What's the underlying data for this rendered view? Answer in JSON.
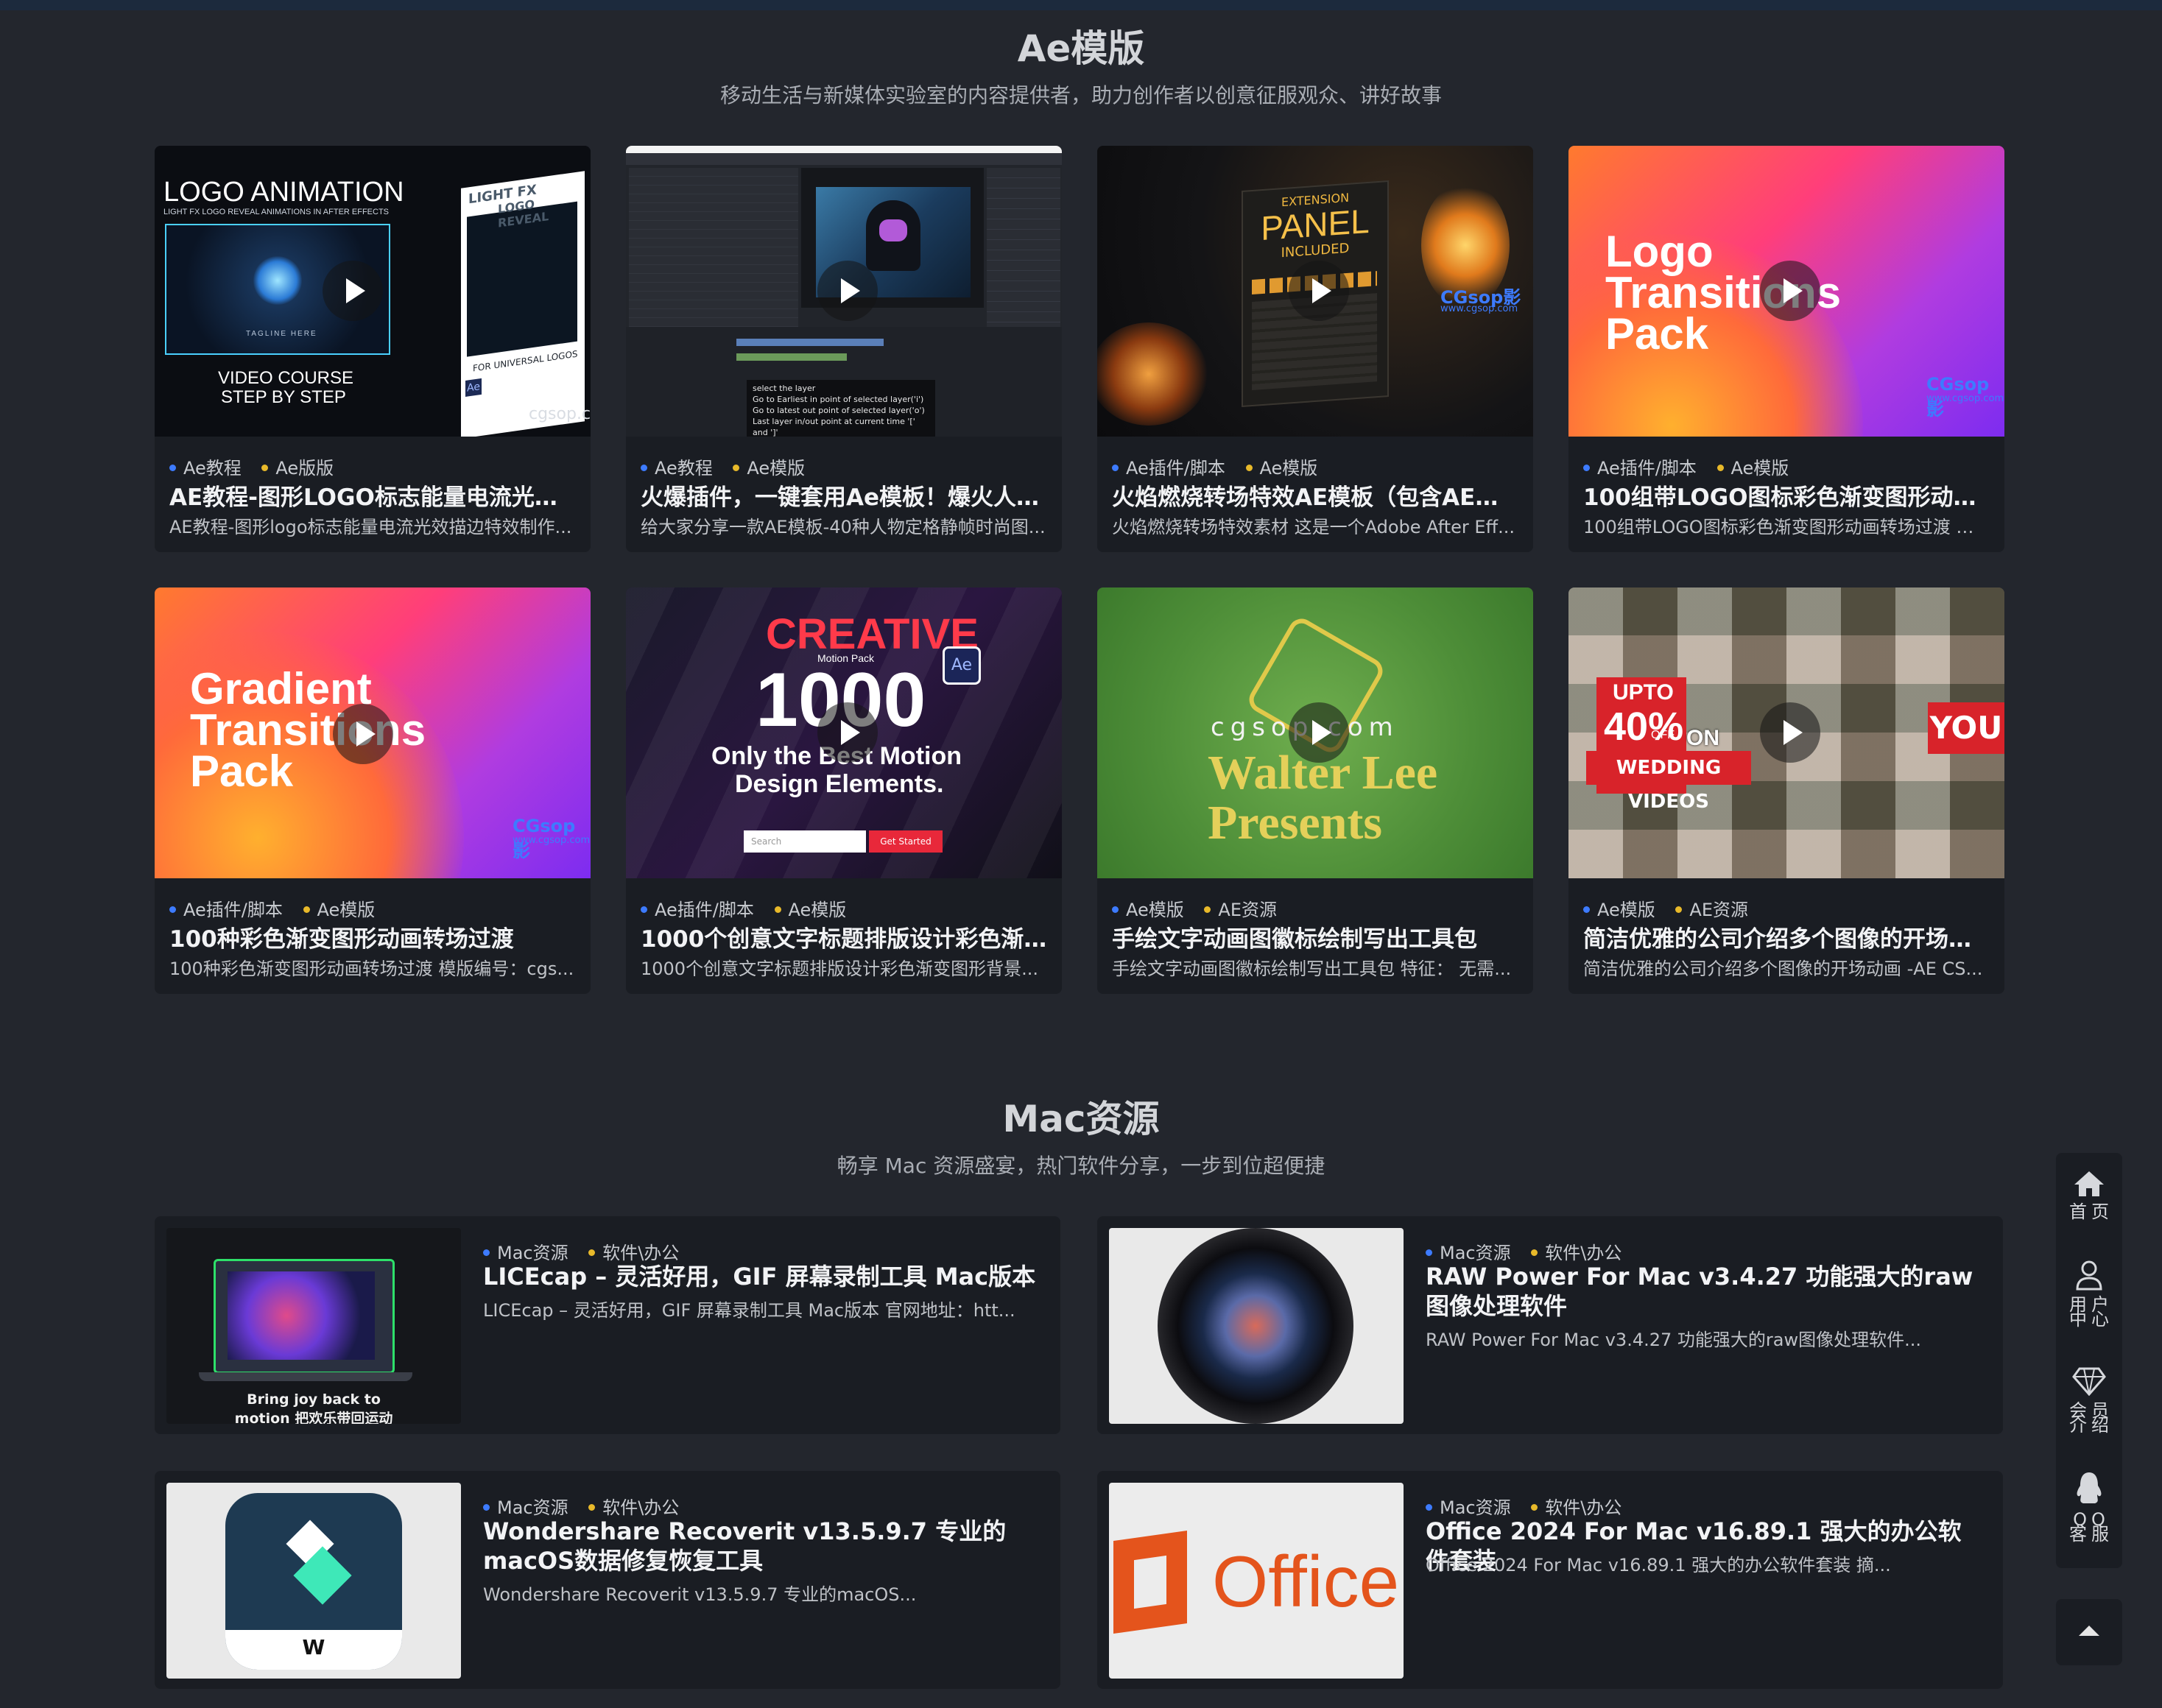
{
  "ae_section": {
    "title": "Ae模版",
    "subtitle": "移动生活与新媒体实验室的内容提供者，助力创作者以创意征服观众、讲好故事",
    "cards": [
      {
        "tags": [
          "Ae教程",
          "Ae版版"
        ],
        "title": "AE教程-图形LOGO标志能量电流光效...",
        "desc": "AE教程-图形logo标志能量电流光效描边特效制作..."
      },
      {
        "tags": [
          "Ae教程",
          "Ae模版"
        ],
        "title": "火爆插件，一键套用Ae模板！爆火人物...",
        "desc": "给大家分享一款AE模板-40种人物定格静帧时尚图..."
      },
      {
        "tags": [
          "Ae插件/脚本",
          "Ae模版"
        ],
        "title": "火焰燃烧转场特效AE模板（包含AE脚...",
        "desc": "火焰燃烧转场特效素材 这是一个Adobe After Eff..."
      },
      {
        "tags": [
          "Ae插件/脚本",
          "Ae模版"
        ],
        "title": "100组带LOGO图标彩色渐变图形动画...",
        "desc": "100组带LOGO图标彩色渐变图形动画转场过渡 模..."
      },
      {
        "tags": [
          "Ae插件/脚本",
          "Ae模版"
        ],
        "title": "100种彩色渐变图形动画转场过渡",
        "desc": "100种彩色渐变图形动画转场过渡 模版编号：cgs..."
      },
      {
        "tags": [
          "Ae插件/脚本",
          "Ae模版"
        ],
        "title": "1000个创意文字标题排版设计彩色渐...",
        "desc": "1000个创意文字标题排版设计彩色渐变图形背景..."
      },
      {
        "tags": [
          "Ae模版",
          "AE资源"
        ],
        "title": "手绘文字动画图徽标绘制写出工具包",
        "desc": "手绘文字动画图徽标绘制写出工具包 特征：  无需..."
      },
      {
        "tags": [
          "Ae模版",
          "AE资源"
        ],
        "title": "简洁优雅的公司介绍多个图像的开场动画",
        "desc": "简洁优雅的公司介绍多个图像的开场动画 -AE CS..."
      }
    ],
    "thumb_text": {
      "logo_anim_title": "LOGO ANIMATION",
      "logo_anim_sub": "LIGHT FX LOGO REVEAL ANIMATIONS IN AFTER EFFECTS",
      "tagline": "TAGLINE HERE",
      "video_course": "VIDEO COURSE",
      "step_by_step": "STEP BY STEP",
      "light_fx": "LIGHT FX",
      "logo_reveal": "LOGO REVEAL",
      "for_universal": "FOR UNIVERSAL LOGOS",
      "cgsop_c": "cgsop.c",
      "ext": "EXTENSION",
      "panel": "PANEL",
      "included": "INCLUDED",
      "cgsop_mark": "CGsop影",
      "cgsop_url": "www.cgsop.com",
      "logo_tr": [
        "Logo",
        "Transitions",
        "Pack"
      ],
      "grad_tr": [
        "Gradient",
        "Transitions",
        "Pack"
      ],
      "creative": "CREATIVE",
      "motion_pack": "Motion Pack",
      "thousand": "1000",
      "only_best": "Only the Best Motion",
      "design_el": "Design Elements.",
      "search": "Search",
      "get_started": "Get Started",
      "cgsop_com": "cgsop.com",
      "walter": "Walter Lee",
      "presents": "Presents",
      "upto": "UPTO",
      "forty": "40%",
      "off": "OFF",
      "on": "ON",
      "wedding": "WEDDING VIDEOS",
      "you": "YOU",
      "ae_badge": "Ae",
      "ae_popup_1": "select the layer",
      "ae_popup_2": "Go to Earliest in point of selected layer('i')",
      "ae_popup_3": "Go to latest out point of selected layer('o')",
      "ae_popup_4": "Last layer in/out point at current time '[' and ']'"
    }
  },
  "mac_section": {
    "title": "Mac资源",
    "subtitle": "畅享 Mac 资源盛宴，热门软件分享，一步到位超便捷",
    "cards": [
      {
        "tags": [
          "Mac资源",
          "软件\\办公"
        ],
        "title": "LICEcap – 灵活好用，GIF 屏幕录制工具 Mac版本",
        "desc": "LICEcap – 灵活好用，GIF 屏幕录制工具 Mac版本 官网地址：htt...",
        "thumb_caption_1": "Bring joy back to",
        "thumb_caption_2": "motion 把欢乐带回运动"
      },
      {
        "tags": [
          "Mac资源",
          "软件\\办公"
        ],
        "title": "RAW Power For Mac v3.4.27 功能强大的raw图像处理软件",
        "desc": "RAW Power For Mac v3.4.27 功能强大的raw图像处理软件..."
      },
      {
        "tags": [
          "Mac资源",
          "软件\\办公"
        ],
        "title": "Wondershare Recoverit v13.5.9.7 专业的macOS数据修复恢复工具",
        "desc": "Wondershare Recoverit v13.5.9.7 专业的macOS..."
      },
      {
        "tags": [
          "Mac资源",
          "软件\\办公"
        ],
        "title": "Office 2024 For Mac v16.89.1 强大的办公软件套装",
        "desc": "Office 2024 For Mac v16.89.1 强大的办公软件套装 摘...",
        "thumb_word": "Office"
      }
    ]
  },
  "sidebar": {
    "home": "首页",
    "user": [
      "用户",
      "中心"
    ],
    "vip": [
      "会员",
      "介绍"
    ],
    "qq": [
      "QQ",
      "客服"
    ]
  },
  "colors": {
    "background": "#23262d",
    "card": "#1a1d23",
    "tag_dot_1": "#3d7bff",
    "tag_dot_2": "#e8b92a"
  }
}
